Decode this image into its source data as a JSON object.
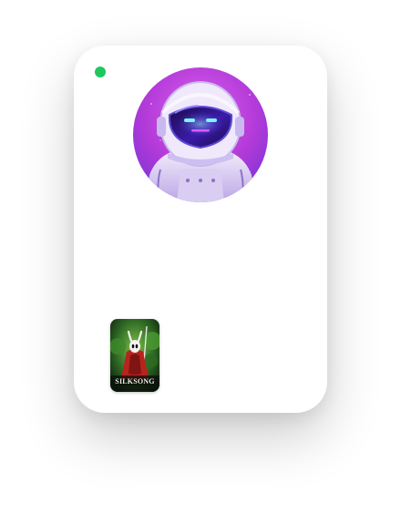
{
  "status": {
    "color": "#1ec760",
    "icon": "online-status-dot"
  },
  "avatar": {
    "icon": "astronaut-avatar",
    "background": "#c43ad6"
  },
  "game": {
    "cover_title": "SILKSONG",
    "icon": "game-cover-art"
  }
}
